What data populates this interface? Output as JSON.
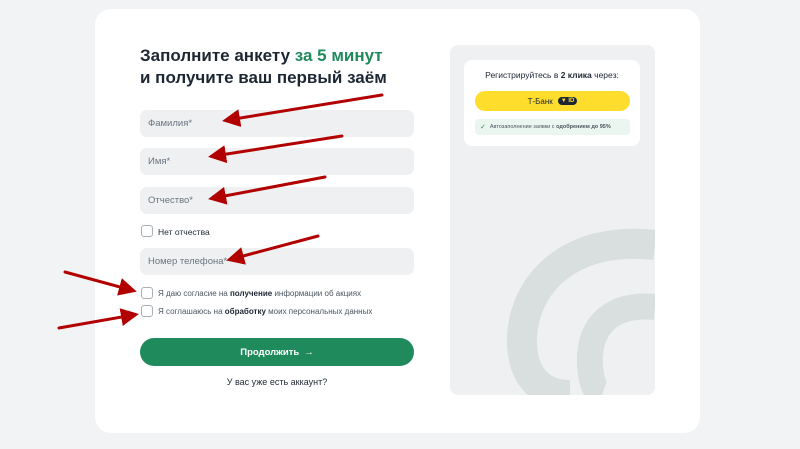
{
  "form": {
    "title_line1": "Заполните анкету ",
    "title_accent": "за 5 минут",
    "title_line2": "и получите ваш первый заём",
    "surname_placeholder": "Фамилия*",
    "name_placeholder": "Имя*",
    "patronymic_placeholder": "Отчество*",
    "no_patronymic_label": "Нет отчества",
    "phone_placeholder": "Номер телефона*",
    "consent_promo_pre": "Я даю согласие на ",
    "consent_promo_bold": "получение",
    "consent_promo_post": " информации об акциях",
    "consent_data_pre": "Я соглашаюсь на ",
    "consent_data_bold": "обработку",
    "consent_data_post": " моих персональных данных",
    "submit_label": "Продолжить",
    "submit_arrow": "→",
    "login_link": "У вас уже есть аккаунт?"
  },
  "side": {
    "register_pre": "Регистрируйтесь в ",
    "register_bold": "2 клика",
    "register_post": " через:",
    "tbank_label": "Т-Банк",
    "tbank_id": "ID",
    "autofill_check": "✓",
    "autofill_pre": "Автозаполнение заявки с ",
    "autofill_bold": "одобрением до 95%"
  },
  "colors": {
    "accent": "#1f8a5b",
    "tbank": "#ffdd2d",
    "annotation": "#b20000"
  },
  "annotation_icons": [
    "arrow-annotation-icon"
  ]
}
